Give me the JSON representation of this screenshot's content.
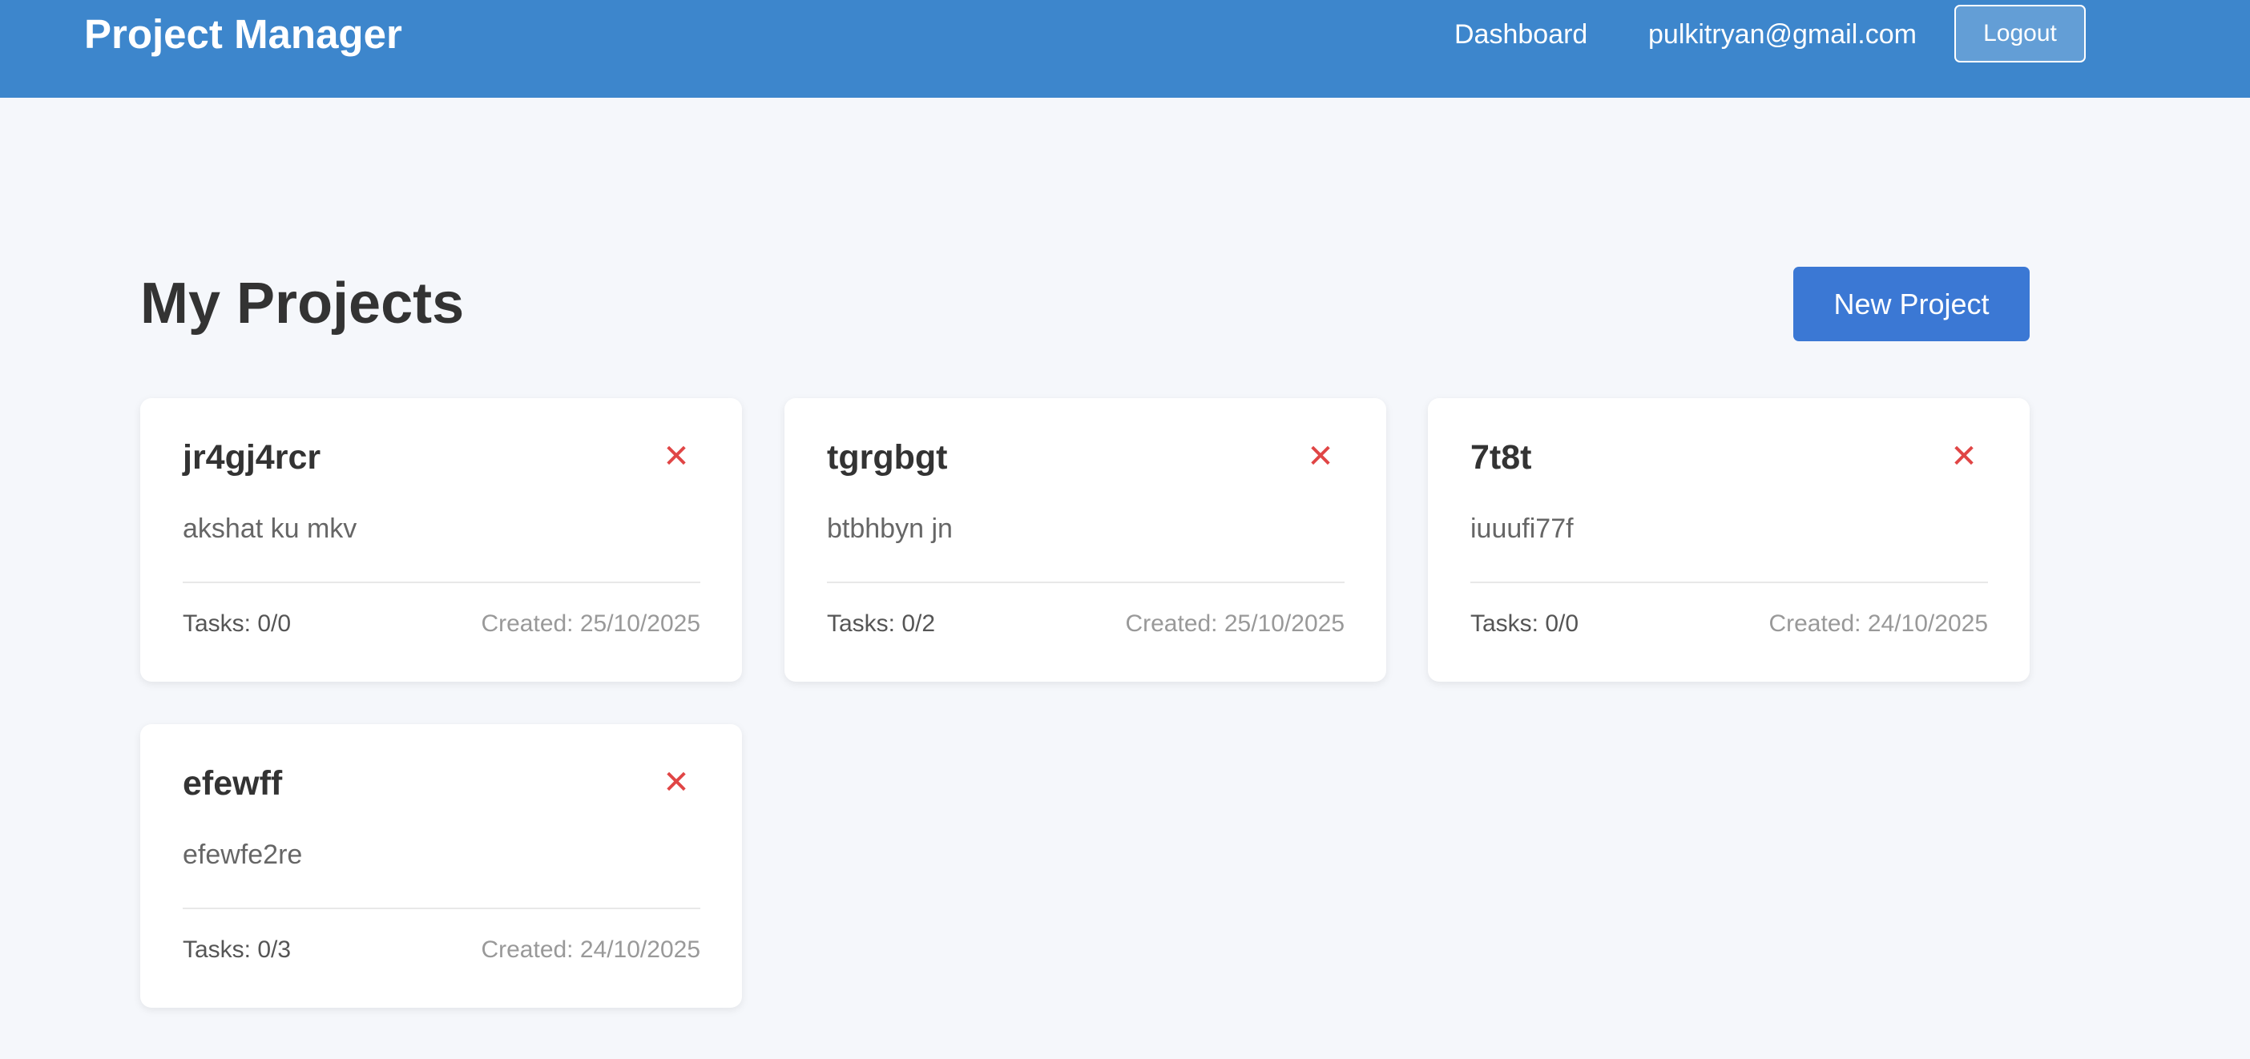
{
  "navbar": {
    "brand": "Project Manager",
    "dashboard_link": "Dashboard",
    "user_email": "pulkitryan@gmail.com",
    "logout_label": "Logout",
    "background_color": "#3d86cc"
  },
  "main": {
    "title": "My Projects",
    "new_project_label": "New Project",
    "projects": [
      {
        "name": "jr4gj4rcr",
        "description": "akshat ku mkv",
        "tasks": "Tasks: 0/0",
        "created": "Created: 25/10/2025",
        "delete_icon": "close-icon"
      },
      {
        "name": "tgrgbgt",
        "description": "btbhbyn jn",
        "tasks": "Tasks: 0/2",
        "created": "Created: 25/10/2025",
        "delete_icon": "close-icon"
      },
      {
        "name": "7t8t",
        "description": "iuuufi77f",
        "tasks": "Tasks: 0/0",
        "created": "Created: 24/10/2025",
        "delete_icon": "close-icon"
      },
      {
        "name": "efewff",
        "description": "efewfe2re",
        "tasks": "Tasks: 0/3",
        "created": "Created: 24/10/2025",
        "delete_icon": "close-icon"
      }
    ]
  },
  "colors": {
    "accent": "#3b78d4",
    "delete": "#e04545",
    "page_background": "#f5f7fb"
  }
}
